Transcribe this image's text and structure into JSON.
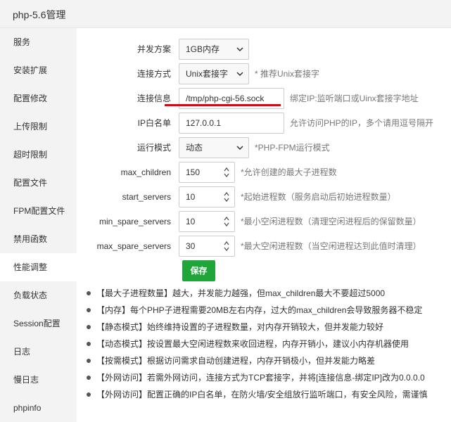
{
  "window": {
    "title": "php-5.6管理"
  },
  "sidebar": {
    "items": [
      {
        "label": "服务"
      },
      {
        "label": "安装扩展"
      },
      {
        "label": "配置修改"
      },
      {
        "label": "上传限制"
      },
      {
        "label": "超时限制"
      },
      {
        "label": "配置文件"
      },
      {
        "label": "FPM配置文件"
      },
      {
        "label": "禁用函数"
      },
      {
        "label": "性能调整",
        "active": true
      },
      {
        "label": "负载状态"
      },
      {
        "label": "Session配置"
      },
      {
        "label": "日志"
      },
      {
        "label": "慢日志"
      },
      {
        "label": "phpinfo"
      }
    ]
  },
  "form": {
    "concurrency": {
      "label": "并发方案",
      "value": "1GB内存"
    },
    "connection_mode": {
      "label": "连接方式",
      "value": "Unix套接字",
      "hint": "* 推荐Unix套接字"
    },
    "connection_info": {
      "label": "连接信息",
      "value": "/tmp/php-cgi-56.sock",
      "hint": "绑定IP:监听端口或Uinx套接字地址"
    },
    "ip_whitelist": {
      "label": "IP白名单",
      "value": "127.0.0.1",
      "hint": "允许访问PHP的IP，多个请用逗号隔开"
    },
    "run_mode": {
      "label": "运行模式",
      "value": "动态",
      "hint": "*PHP-FPM运行模式"
    },
    "max_children": {
      "label": "max_children",
      "value": "150",
      "hint": "*允许创建的最大子进程数"
    },
    "start_servers": {
      "label": "start_servers",
      "value": "10",
      "hint": "*起始进程数（服务启动后初始进程数量）"
    },
    "min_spare_servers": {
      "label": "min_spare_servers",
      "value": "10",
      "hint": "*最小空闲进程数（清理空闲进程后的保留数量）"
    },
    "max_spare_servers": {
      "label": "max_spare_servers",
      "value": "30",
      "hint": "*最大空闲进程数（当空闲进程达到此值时清理）"
    },
    "save_label": "保存"
  },
  "tips": [
    "【最大子进程数量】越大，并发能力越强，但max_children最大不要超过5000",
    "【内存】每个PHP子进程需要20MB左右内存，过大的max_children会导致服务器不稳定",
    "【静态模式】始终维持设置的子进程数量，对内存开销较大，但并发能力较好",
    "【动态模式】按设置最大空闲进程数来收回进程，内存开销小，建议小内存机器使用",
    "【按需模式】根据访问需求自动创建进程，内存开销极小，但并发能力略差",
    "【外网访问】若需外网访问，连接方式为TCP套接字，并将[连接信息-绑定IP]改为0.0.0.0",
    "【外网访问】配置正确的IP白名单，在防火墙/安全组放行监听端口，有安全风险，需谨慎"
  ],
  "colors": {
    "accent": "#20a53a",
    "annotation": "#e60012"
  }
}
